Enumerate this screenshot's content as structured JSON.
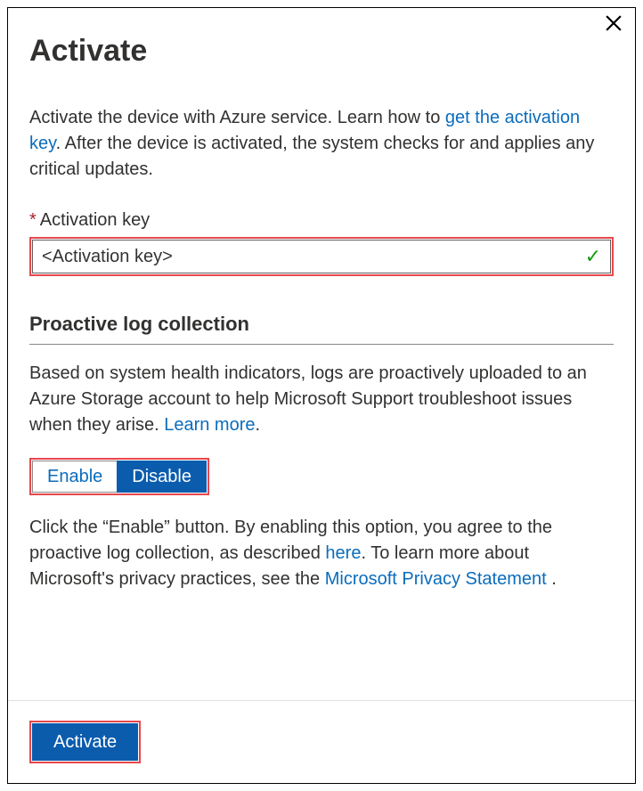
{
  "title": "Activate",
  "intro": {
    "part1": "Activate the device with Azure service. Learn how to ",
    "link1": "get the activation key",
    "part2": ". After the device is activated, the system checks for and applies any critical updates."
  },
  "field": {
    "label": "Activation key",
    "value": "<Activation key>"
  },
  "section": {
    "title": "Proactive log collection",
    "desc_part1": "Based on system health indicators, logs are proactively uploaded to an Azure Storage account to help Microsoft Support troubleshoot issues when they arise. ",
    "desc_link": "Learn more",
    "desc_part2": ".",
    "toggle_enable": "Enable",
    "toggle_disable": "Disable",
    "agree_part1": "Click the “Enable” button. By enabling this option, you agree to the proactive log collection, as described ",
    "agree_link1": "here",
    "agree_part2": ". To learn more about Microsoft's privacy practices, see the ",
    "agree_link2": "Microsoft Privacy Statement",
    "agree_part3": " ."
  },
  "footer": {
    "activate": "Activate"
  }
}
